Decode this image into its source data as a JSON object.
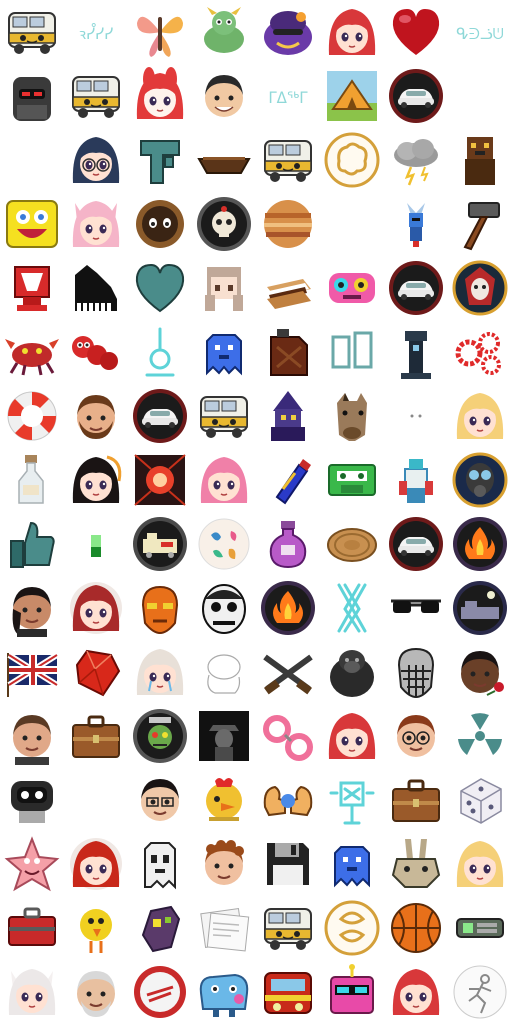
{
  "grid": {
    "columns": 8,
    "rows": 16
  },
  "icons": [
    [
      "rv-bus-icon",
      "glyph-text-icon",
      "butterfly-icon",
      "dragon-creature-icon",
      "purple-ogre-icon",
      "red-hair-anime-girl-icon",
      "red-heart-icon",
      "glyph-text-icon"
    ],
    [
      "armored-soldier-icon",
      "rv-bus-icon",
      "red-bunny-girl-icon",
      "smiling-man-icon",
      "glyph-text-icon",
      "camping-tent-icon",
      "white-sports-car-badge-icon",
      ""
    ],
    [
      "",
      "anime-girl-glasses-icon",
      "teal-pipe-icon",
      "wooden-boat-icon",
      "rv-bus-icon",
      "brain-gold-badge-icon",
      "storm-cloud-icon",
      "brown-creature-icon"
    ],
    [
      "yellow-sponge-face-icon",
      "pink-cat-girl-icon",
      "cookie-creature-icon",
      "skull-gear-badge-icon",
      "planet-jupiter-icon",
      "",
      "shovel-knight-icon",
      "hammer-icon"
    ],
    [
      "red-cube-icon",
      "piano-icon",
      "teal-heart-icon",
      "pixel-girl-icon",
      "smore-icon",
      "pink-monster-icon",
      "white-sports-car-badge-icon",
      "skeleton-woman-badge-icon"
    ],
    [
      "red-crab-icon",
      "red-caterpillar-icon",
      "neon-ring-icon",
      "blue-pixel-ghost-icon",
      "jerry-can-icon",
      "teal-panels-icon",
      "dark-pillar-icon",
      "red-gears-icon"
    ],
    [
      "life-ring-icon",
      "bearded-man-icon",
      "white-sports-car-badge-icon",
      "rv-bus-icon",
      "pixel-wizard-icon",
      "horse-head-icon",
      "small-dots-icon",
      "blonde-anime-face-icon"
    ],
    [
      "bottle-icon",
      "dark-hair-girl-icon",
      "red-orb-icon",
      "pink-anime-girl-icon",
      "spray-can-icon",
      "green-cassette-icon",
      "pixel-robot-icon",
      "gas-mask-badge-icon"
    ],
    [
      "thumbs-up-icon",
      "green-pixel-icon",
      "train-badge-icon",
      "cat-pattern-plate-icon",
      "potion-bottle-icon",
      "coin-icon",
      "white-sports-car-badge-icon",
      "campfire-badge-icon"
    ],
    [
      "woman-portrait-icon",
      "red-hair-face-icon",
      "orange-mask-icon",
      "creepy-face-icon",
      "campfire-badge-icon",
      "neon-cross-icon",
      "sunglasses-icon",
      "night-train-badge-icon"
    ],
    [
      "union-jack-flag-icon",
      "red-gem-icon",
      "crying-anime-girl-icon",
      "sketch-face-icon",
      "crossed-rifles-icon",
      "gorilla-icon",
      "hockey-mask-icon",
      "man-with-rose-icon"
    ],
    [
      "man-portrait-icon",
      "briefcase-icon",
      "zombie-gear-badge-icon",
      "dark-figure-icon",
      "pink-handcuffs-icon",
      "red-hair-anime-girl-icon",
      "woman-glasses-icon",
      "radiation-icon"
    ],
    [
      "robot-head-icon",
      "",
      "man-glasses-icon",
      "chicken-icon",
      "flexing-arms-icon",
      "neon-machine-icon",
      "briefcase-icon",
      "dice-icon"
    ],
    [
      "patrick-star-icon",
      "redhead-woman-badge-icon",
      "pixel-ghost-icon",
      "curly-hair-man-icon",
      "floppy-disk-icon",
      "blue-pixel-ghost-icon",
      "pixel-rabbit-icon",
      "blonde-anime-face-icon"
    ],
    [
      "red-toolbox-icon",
      "yellow-bird-icon",
      "pixel-eggplant-icon",
      "papers-icon",
      "rv-bus-icon",
      "gold-symbol-badge-icon",
      "basketball-icon",
      "green-device-icon"
    ],
    [
      "white-cat-girl-icon",
      "old-man-portrait-icon",
      "red-ring-badge-icon",
      "blue-creature-icon",
      "red-train-icon",
      "pink-robot-icon",
      "red-hair-anime-girl-icon",
      "sketch-runner-icon"
    ]
  ],
  "glyph_texts": {
    "r0c1": "ꝛᓮᓯᓯ",
    "r0c7": "ᕴᕭᓘᕫ",
    "r1c4": "ᒥᐃᖅᒥ"
  },
  "colors": {
    "background": "#ffffff",
    "bus_yellow": "#e8b830",
    "neon_teal": "#5ed3d8",
    "badge_red": "#c9302c",
    "badge_dark": "#2b2b2b",
    "gold": "#d4a03a"
  }
}
